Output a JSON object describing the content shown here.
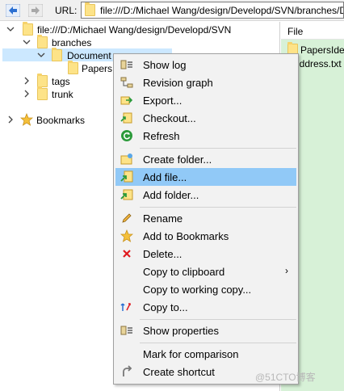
{
  "toolbar": {
    "url_label": "URL:",
    "url_value": "file:///D:/Michael Wang/design/Developd/SVN/branches/Document"
  },
  "tree": {
    "root": "file:///D:/Michael Wang/design/Developd/SVN",
    "branches": "branches",
    "document": "Document",
    "papers": "PapersIdea",
    "tags": "tags",
    "trunk": "trunk",
    "bookmarks": "Bookmarks"
  },
  "files": {
    "header": "File",
    "items": [
      "PapersIdea",
      "iddress.txt"
    ]
  },
  "menu": {
    "show_log": "Show log",
    "revision_graph": "Revision graph",
    "export": "Export...",
    "checkout": "Checkout...",
    "refresh": "Refresh",
    "create_folder": "Create folder...",
    "add_file": "Add file...",
    "add_folder": "Add folder...",
    "rename": "Rename",
    "add_bookmarks": "Add to Bookmarks",
    "delete": "Delete...",
    "copy_clipboard": "Copy to clipboard",
    "copy_working": "Copy to working copy...",
    "copy_to": "Copy to...",
    "show_properties": "Show properties",
    "mark_comparison": "Mark for comparison",
    "create_shortcut": "Create shortcut",
    "submenu_arrow": "›"
  },
  "watermark": "@51CTO博客"
}
